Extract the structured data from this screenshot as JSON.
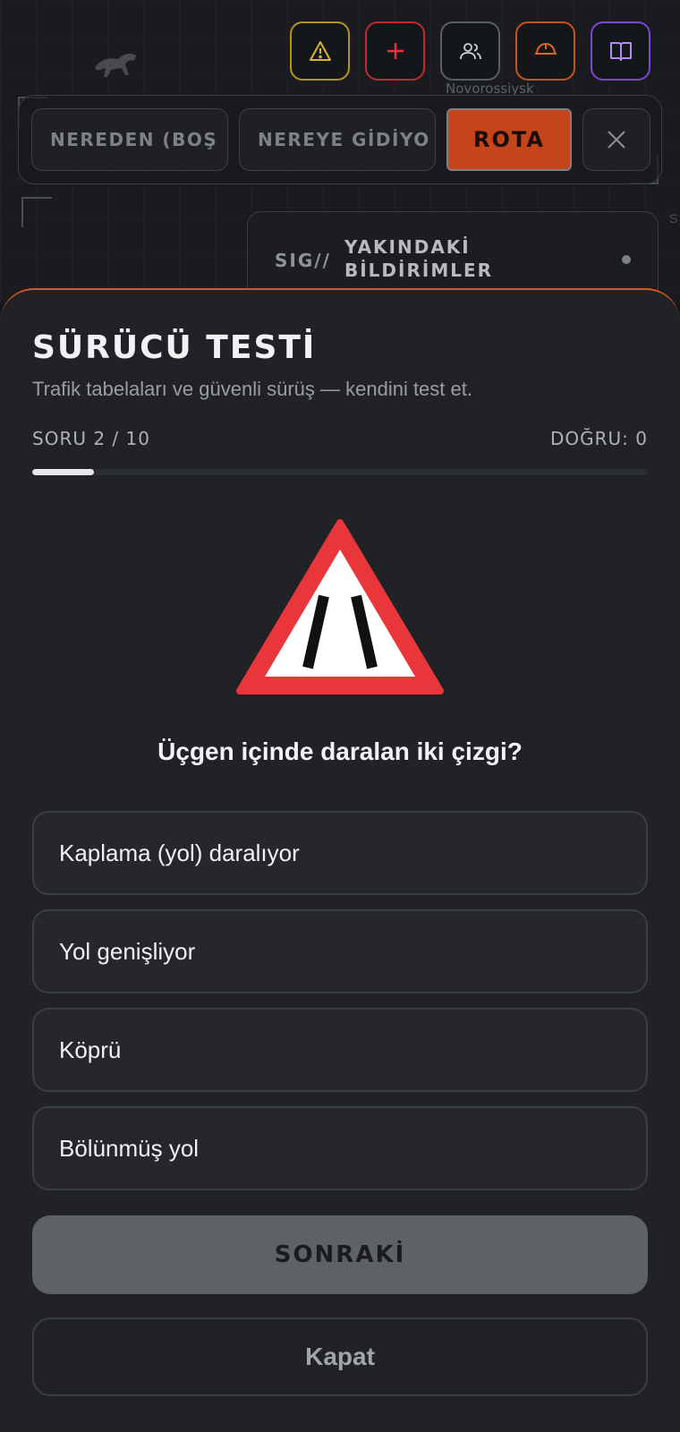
{
  "map": {
    "city_label": "Novorossiysk",
    "edge_letter": "S"
  },
  "top_actions": [
    {
      "icon": "warning-icon",
      "color": "#d9b42a"
    },
    {
      "icon": "plus-icon",
      "color": "#e5353a"
    },
    {
      "icon": "users-icon",
      "color": "#cfd1d4"
    },
    {
      "icon": "helmet-icon",
      "color": "#e4622a"
    },
    {
      "icon": "book-icon",
      "color": "#b08cf3"
    }
  ],
  "route": {
    "from_placeholder": "NEREDEN (BOŞ",
    "to_placeholder": "NEREYE GİDİYO",
    "route_button": "ROTA",
    "accent": "#c4451a"
  },
  "notifications": {
    "tag": "SIG//",
    "title": "YAKINDAKİ BİLDİRİMLER"
  },
  "quiz": {
    "title": "SÜRÜCÜ TESTİ",
    "subtitle": "Trafik tabelaları ve güvenli sürüş — kendini test et.",
    "progress_text": "SORU 2 / 10",
    "score_text": "DOĞRU: 0",
    "progress_fraction": 0.1,
    "sign_icon": "road-narrows-warning-sign",
    "question": "Üçgen içinde daralan iki çizgi?",
    "options": [
      "Kaplama (yol) daralıyor",
      "Yol genişliyor",
      "Köprü",
      "Bölünmüş yol"
    ],
    "next_button": "SONRAKİ",
    "close_button": "Kapat",
    "accent": "#d25a24"
  }
}
